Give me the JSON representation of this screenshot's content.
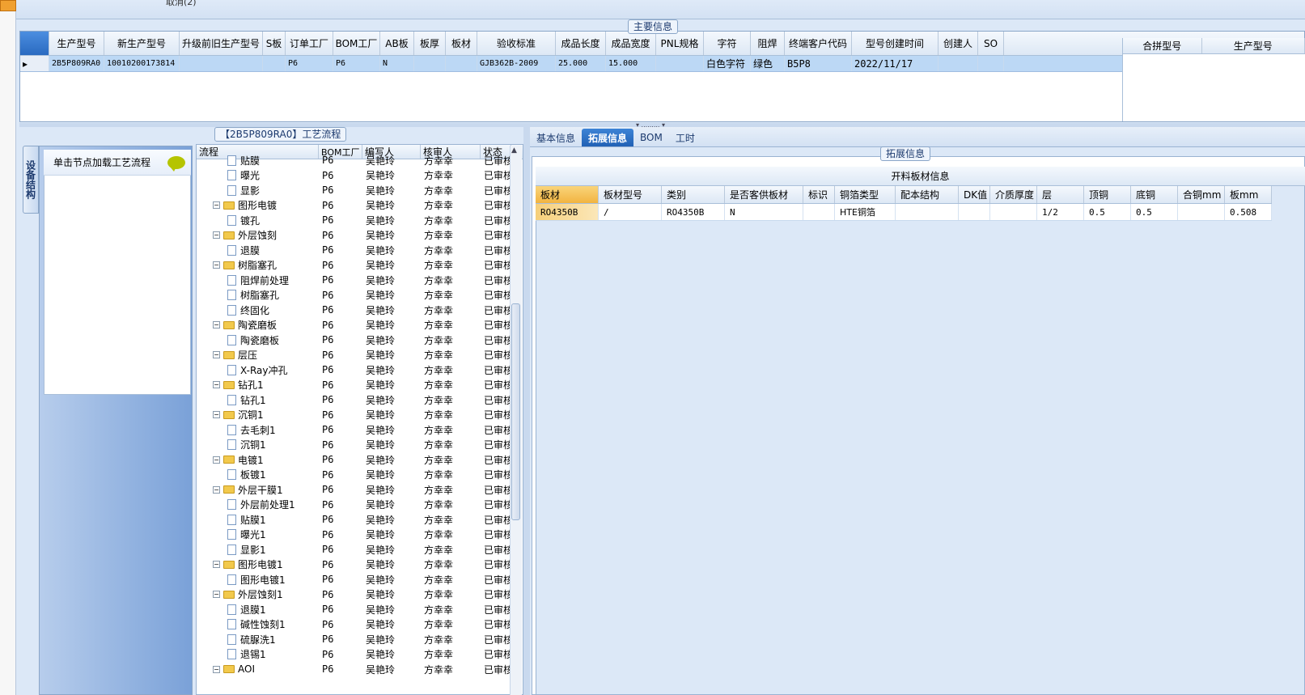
{
  "top": {
    "cancel_label": "取消(2)"
  },
  "main_info": {
    "title": "主要信息",
    "columns": [
      "生产型号",
      "新生产型号",
      "升级前旧生产型号",
      "S板",
      "订单工厂",
      "BOM工厂",
      "AB板",
      "板厚",
      "板材",
      "验收标准",
      "成品长度",
      "成品宽度",
      "PNL规格",
      "字符",
      "阻焊",
      "终端客户代码",
      "型号创建时间",
      "创建人",
      "SO"
    ],
    "row": {
      "生产型号": "2B5P809RA0",
      "新生产型号": "10010200173814",
      "升级前旧生产型号": "",
      "S板": "",
      "订单工厂": "P6",
      "BOM工厂": "P6",
      "AB板": "N",
      "板厚": "",
      "板材": "",
      "验收标准": "GJB362B-2009",
      "成品长度": "25.000",
      "成品宽度": "15.000",
      "PNL规格": "",
      "字符": "白色字符",
      "阻焊": "绿色",
      "终端客户代码": "B5P8",
      "型号创建时间": "2022/11/17",
      "创建人": "",
      "SO": ""
    },
    "right_columns": [
      "合拼型号",
      "生产型号"
    ]
  },
  "process": {
    "title": "【2B5P809RA0】工艺流程",
    "side_tab": "设备结构",
    "node_hint": "单击节点加载工艺流程",
    "columns": [
      "流程",
      "BOM工厂",
      "编写人",
      "核审人",
      "状态"
    ],
    "rows": [
      {
        "name": "贴膜",
        "type": "doc",
        "bom": "P6",
        "writer": "吴艳玲",
        "reviewer": "方幸幸",
        "status": "已审核"
      },
      {
        "name": "曝光",
        "type": "doc",
        "bom": "P6",
        "writer": "吴艳玲",
        "reviewer": "方幸幸",
        "status": "已审核"
      },
      {
        "name": "显影",
        "type": "doc",
        "bom": "P6",
        "writer": "吴艳玲",
        "reviewer": "方幸幸",
        "status": "已审核"
      },
      {
        "name": "图形电镀",
        "type": "folder",
        "bom": "P6",
        "writer": "吴艳玲",
        "reviewer": "方幸幸",
        "status": "已审核"
      },
      {
        "name": "镀孔",
        "type": "doc",
        "bom": "P6",
        "writer": "吴艳玲",
        "reviewer": "方幸幸",
        "status": "已审核"
      },
      {
        "name": "外层蚀刻",
        "type": "folder",
        "bom": "P6",
        "writer": "吴艳玲",
        "reviewer": "方幸幸",
        "status": "已审核"
      },
      {
        "name": "退膜",
        "type": "doc",
        "bom": "P6",
        "writer": "吴艳玲",
        "reviewer": "方幸幸",
        "status": "已审核"
      },
      {
        "name": "树脂塞孔",
        "type": "folder",
        "bom": "P6",
        "writer": "吴艳玲",
        "reviewer": "方幸幸",
        "status": "已审核"
      },
      {
        "name": "阻焊前处理",
        "type": "doc",
        "bom": "P6",
        "writer": "吴艳玲",
        "reviewer": "方幸幸",
        "status": "已审核"
      },
      {
        "name": "树脂塞孔",
        "type": "doc",
        "bom": "P6",
        "writer": "吴艳玲",
        "reviewer": "方幸幸",
        "status": "已审核"
      },
      {
        "name": "终固化",
        "type": "doc",
        "bom": "P6",
        "writer": "吴艳玲",
        "reviewer": "方幸幸",
        "status": "已审核"
      },
      {
        "name": "陶瓷磨板",
        "type": "folder",
        "bom": "P6",
        "writer": "吴艳玲",
        "reviewer": "方幸幸",
        "status": "已审核"
      },
      {
        "name": "陶瓷磨板",
        "type": "doc",
        "bom": "P6",
        "writer": "吴艳玲",
        "reviewer": "方幸幸",
        "status": "已审核"
      },
      {
        "name": "层压",
        "type": "folder",
        "bom": "P6",
        "writer": "吴艳玲",
        "reviewer": "方幸幸",
        "status": "已审核"
      },
      {
        "name": "X-Ray冲孔",
        "type": "doc",
        "bom": "P6",
        "writer": "吴艳玲",
        "reviewer": "方幸幸",
        "status": "已审核"
      },
      {
        "name": "钻孔1",
        "type": "folder",
        "bom": "P6",
        "writer": "吴艳玲",
        "reviewer": "方幸幸",
        "status": "已审核"
      },
      {
        "name": "钻孔1",
        "type": "doc",
        "bom": "P6",
        "writer": "吴艳玲",
        "reviewer": "方幸幸",
        "status": "已审核"
      },
      {
        "name": "沉铜1",
        "type": "folder",
        "bom": "P6",
        "writer": "吴艳玲",
        "reviewer": "方幸幸",
        "status": "已审核"
      },
      {
        "name": "去毛刺1",
        "type": "doc",
        "bom": "P6",
        "writer": "吴艳玲",
        "reviewer": "方幸幸",
        "status": "已审核"
      },
      {
        "name": "沉铜1",
        "type": "doc",
        "bom": "P6",
        "writer": "吴艳玲",
        "reviewer": "方幸幸",
        "status": "已审核"
      },
      {
        "name": "电镀1",
        "type": "folder",
        "bom": "P6",
        "writer": "吴艳玲",
        "reviewer": "方幸幸",
        "status": "已审核"
      },
      {
        "name": "板镀1",
        "type": "doc",
        "bom": "P6",
        "writer": "吴艳玲",
        "reviewer": "方幸幸",
        "status": "已审核"
      },
      {
        "name": "外层干膜1",
        "type": "folder",
        "bom": "P6",
        "writer": "吴艳玲",
        "reviewer": "方幸幸",
        "status": "已审核"
      },
      {
        "name": "外层前处理1",
        "type": "doc",
        "bom": "P6",
        "writer": "吴艳玲",
        "reviewer": "方幸幸",
        "status": "已审核"
      },
      {
        "name": "贴膜1",
        "type": "doc",
        "bom": "P6",
        "writer": "吴艳玲",
        "reviewer": "方幸幸",
        "status": "已审核"
      },
      {
        "name": "曝光1",
        "type": "doc",
        "bom": "P6",
        "writer": "吴艳玲",
        "reviewer": "方幸幸",
        "status": "已审核"
      },
      {
        "name": "显影1",
        "type": "doc",
        "bom": "P6",
        "writer": "吴艳玲",
        "reviewer": "方幸幸",
        "status": "已审核"
      },
      {
        "name": "图形电镀1",
        "type": "folder",
        "bom": "P6",
        "writer": "吴艳玲",
        "reviewer": "方幸幸",
        "status": "已审核"
      },
      {
        "name": "图形电镀1",
        "type": "doc",
        "bom": "P6",
        "writer": "吴艳玲",
        "reviewer": "方幸幸",
        "status": "已审核"
      },
      {
        "name": "外层蚀刻1",
        "type": "folder",
        "bom": "P6",
        "writer": "吴艳玲",
        "reviewer": "方幸幸",
        "status": "已审核"
      },
      {
        "name": "退膜1",
        "type": "doc",
        "bom": "P6",
        "writer": "吴艳玲",
        "reviewer": "方幸幸",
        "status": "已审核"
      },
      {
        "name": "碱性蚀刻1",
        "type": "doc",
        "bom": "P6",
        "writer": "吴艳玲",
        "reviewer": "方幸幸",
        "status": "已审核"
      },
      {
        "name": "硫脲洗1",
        "type": "doc",
        "bom": "P6",
        "writer": "吴艳玲",
        "reviewer": "方幸幸",
        "status": "已审核"
      },
      {
        "name": "退锡1",
        "type": "doc",
        "bom": "P6",
        "writer": "吴艳玲",
        "reviewer": "方幸幸",
        "status": "已审核"
      },
      {
        "name": "AOI",
        "type": "folder",
        "bom": "P6",
        "writer": "吴艳玲",
        "reviewer": "方幸幸",
        "status": "已审核"
      }
    ]
  },
  "tabs": [
    {
      "label": "基本信息",
      "active": false
    },
    {
      "label": "拓展信息",
      "active": true
    },
    {
      "label": "BOM",
      "active": false
    },
    {
      "label": "工时",
      "active": false
    }
  ],
  "ext": {
    "title": "拓展信息",
    "caption": "开料板材信息",
    "columns": [
      "板材",
      "板材型号",
      "类别",
      "是否客供板材",
      "标识",
      "铜箔类型",
      "配本结构",
      "DK值",
      "介质厚度",
      "层",
      "顶铜",
      "底铜",
      "合铜mm",
      "板mm"
    ],
    "row": [
      "RO4350B",
      "/",
      "RO4350B",
      "N",
      "",
      "HTE铜箔",
      "",
      "",
      "",
      "1/2",
      "0.5",
      "0.5",
      "",
      "0.508"
    ]
  },
  "colors": {
    "accent": "#2161b5",
    "selected_row": "#bcd8f5",
    "highlight": "#f2b441"
  }
}
